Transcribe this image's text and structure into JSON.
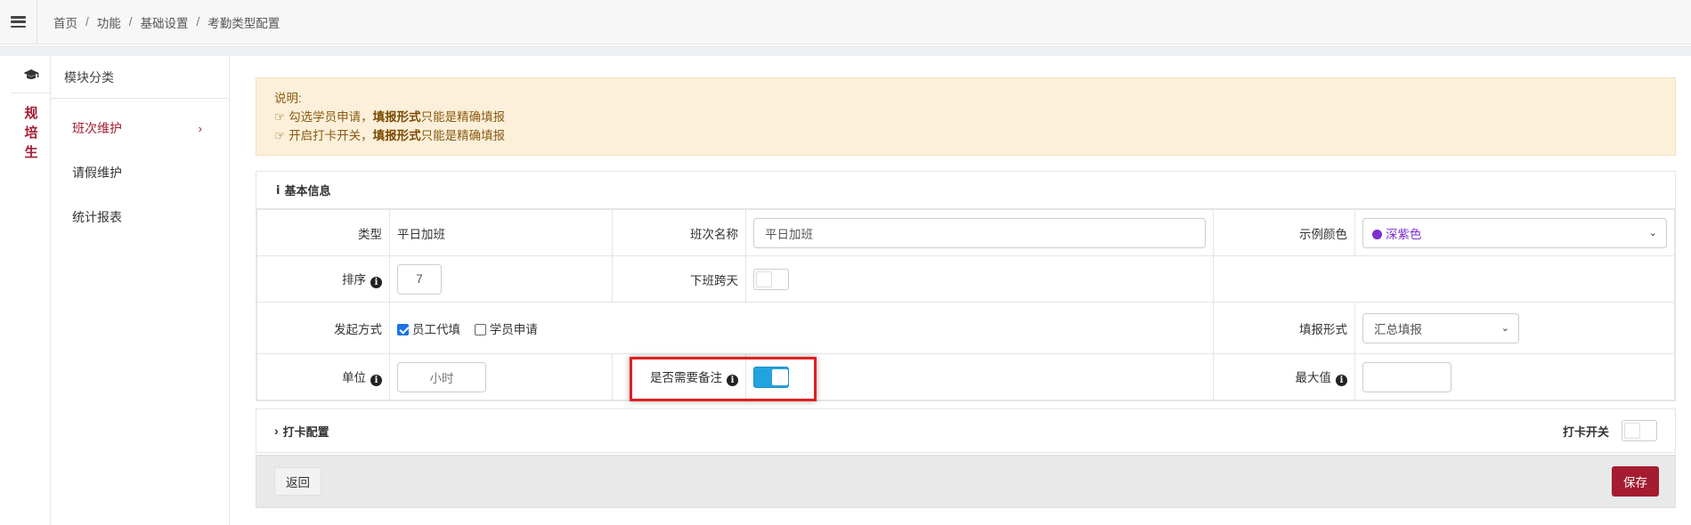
{
  "breadcrumb": [
    "首页",
    "功能",
    "基础设置",
    "考勤类型配置"
  ],
  "sidebar": {
    "vertical_tab": "规培生",
    "module_title": "模块分类",
    "items": [
      {
        "label": "班次维护",
        "active": true
      },
      {
        "label": "请假维护",
        "active": false
      },
      {
        "label": "统计报表",
        "active": false
      }
    ]
  },
  "notice": {
    "title": "说明:",
    "lines": [
      {
        "prefix": "勾选学员申请，",
        "bold": "填报形式",
        "suffix": "只能是精确填报"
      },
      {
        "prefix": "开启打卡开关，",
        "bold": "填报形式",
        "suffix": "只能是精确填报"
      }
    ]
  },
  "basic": {
    "title": "基本信息",
    "type_label": "类型",
    "type_value": "平日加班",
    "shift_name_label": "班次名称",
    "shift_name_value": "平日加班",
    "color_label": "示例颜色",
    "color_value": "深紫色",
    "color_hex": "#7b2fd0",
    "order_label": "排序",
    "order_value": "7",
    "cross_day_label": "下班跨天",
    "cross_day_on": false,
    "initiate_label": "发起方式",
    "initiate_options": [
      {
        "label": "员工代填",
        "checked": true
      },
      {
        "label": "学员申请",
        "checked": false
      }
    ],
    "fill_form_label": "填报形式",
    "fill_form_value": "汇总填报",
    "unit_label": "单位",
    "unit_placeholder": "小时",
    "remark_label": "是否需要备注",
    "remark_on": true,
    "max_label": "最大值",
    "max_value": ""
  },
  "punch": {
    "title": "打卡配置",
    "switch_label": "打卡开关",
    "switch_on": false
  },
  "footer": {
    "back_label": "返回",
    "save_label": "保存"
  },
  "colors": {
    "brand": "#a51c30",
    "toggle_on": "#22a3e0",
    "notice_bg": "#fcf0db"
  }
}
